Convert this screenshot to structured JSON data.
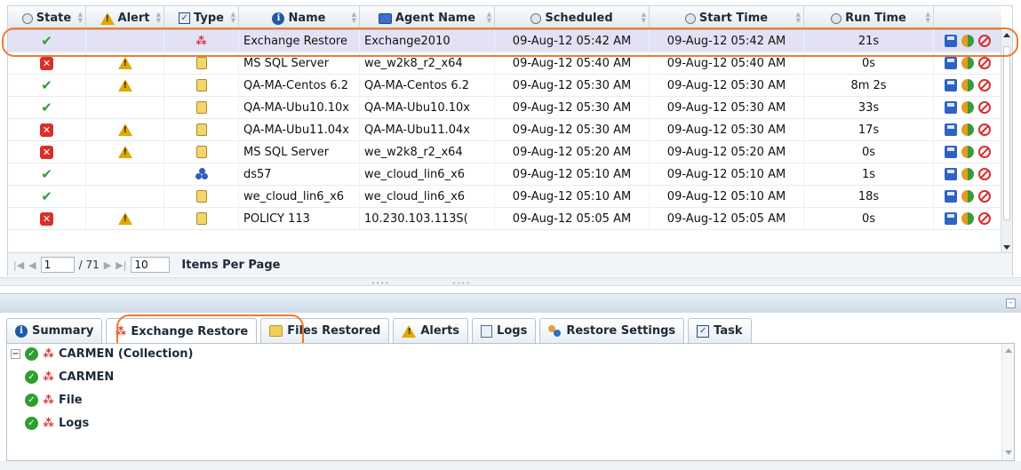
{
  "columns": [
    {
      "key": "state",
      "label": "State",
      "icon": "circle-icon"
    },
    {
      "key": "alert",
      "label": "Alert",
      "icon": "warning-icon"
    },
    {
      "key": "type",
      "label": "Type",
      "icon": "type-icon"
    },
    {
      "key": "name",
      "label": "Name",
      "icon": "info-icon"
    },
    {
      "key": "agent",
      "label": "Agent Name",
      "icon": "computer-icon"
    },
    {
      "key": "scheduled",
      "label": "Scheduled",
      "icon": "clock-icon"
    },
    {
      "key": "start",
      "label": "Start Time",
      "icon": "clock-icon"
    },
    {
      "key": "run",
      "label": "Run Time",
      "icon": "stopwatch-icon"
    }
  ],
  "jobs": [
    {
      "state": "success",
      "alert": false,
      "type": "exchange",
      "name": "Exchange Restore",
      "agent": "Exchange2010",
      "scheduled": "09-Aug-12 05:42 AM",
      "start": "09-Aug-12 05:42 AM",
      "run": "21s",
      "selected": true
    },
    {
      "state": "failed",
      "alert": true,
      "type": "file",
      "name": "MS SQL Server",
      "agent": "we_w2k8_r2_x64",
      "scheduled": "09-Aug-12 05:40 AM",
      "start": "09-Aug-12 05:40 AM",
      "run": "0s"
    },
    {
      "state": "success",
      "alert": true,
      "type": "file",
      "name": "QA-MA-Centos 6.2",
      "agent": "QA-MA-Centos 6.2",
      "scheduled": "09-Aug-12 05:30 AM",
      "start": "09-Aug-12 05:30 AM",
      "run": "8m 2s"
    },
    {
      "state": "success",
      "alert": false,
      "type": "file",
      "name": "QA-MA-Ubu10.10x",
      "agent": "QA-MA-Ubu10.10x",
      "scheduled": "09-Aug-12 05:30 AM",
      "start": "09-Aug-12 05:30 AM",
      "run": "33s"
    },
    {
      "state": "failed",
      "alert": true,
      "type": "file",
      "name": "QA-MA-Ubu11.04x",
      "agent": "QA-MA-Ubu11.04x",
      "scheduled": "09-Aug-12 05:30 AM",
      "start": "09-Aug-12 05:30 AM",
      "run": "17s"
    },
    {
      "state": "failed",
      "alert": true,
      "type": "file",
      "name": "MS SQL Server",
      "agent": "we_w2k8_r2_x64",
      "scheduled": "09-Aug-12 05:20 AM",
      "start": "09-Aug-12 05:20 AM",
      "run": "0s"
    },
    {
      "state": "success",
      "alert": false,
      "type": "cluster",
      "name": "ds57",
      "agent": "we_cloud_lin6_x6",
      "scheduled": "09-Aug-12 05:10 AM",
      "start": "09-Aug-12 05:10 AM",
      "run": "1s"
    },
    {
      "state": "success",
      "alert": false,
      "type": "file",
      "name": "we_cloud_lin6_x6",
      "agent": "we_cloud_lin6_x6",
      "scheduled": "09-Aug-12 05:10 AM",
      "start": "09-Aug-12 05:10 AM",
      "run": "18s"
    },
    {
      "state": "failed",
      "alert": true,
      "type": "file",
      "name": "POLICY 113",
      "agent": "10.230.103.113S(",
      "scheduled": "09-Aug-12 05:05 AM",
      "start": "09-Aug-12 05:05 AM",
      "run": "0s"
    }
  ],
  "pager": {
    "page": "1",
    "total": "/ 71",
    "per_page": "10",
    "per_page_label": "Items Per Page"
  },
  "tabs": [
    {
      "label": "Summary",
      "icon": "info-icon"
    },
    {
      "label": "Exchange Restore",
      "icon": "exchange-icon",
      "active": true
    },
    {
      "label": "Files Restored",
      "icon": "files-icon"
    },
    {
      "label": "Alerts",
      "icon": "warning-icon"
    },
    {
      "label": "Logs",
      "icon": "logs-icon"
    },
    {
      "label": "Restore Settings",
      "icon": "settings-icon"
    },
    {
      "label": "Task",
      "icon": "task-icon"
    }
  ],
  "tree": [
    {
      "label": "CARMEN (Collection)",
      "level": 0,
      "expanded": true
    },
    {
      "label": "CARMEN",
      "level": 1
    },
    {
      "label": "File",
      "level": 1
    },
    {
      "label": "Logs",
      "level": 1
    }
  ],
  "colors": {
    "selection_row": "#e2e2f4",
    "highlight_ring": "#ee7b33",
    "success": "#2f9e2f",
    "failed": "#d9302a",
    "warning": "#e0a800"
  }
}
